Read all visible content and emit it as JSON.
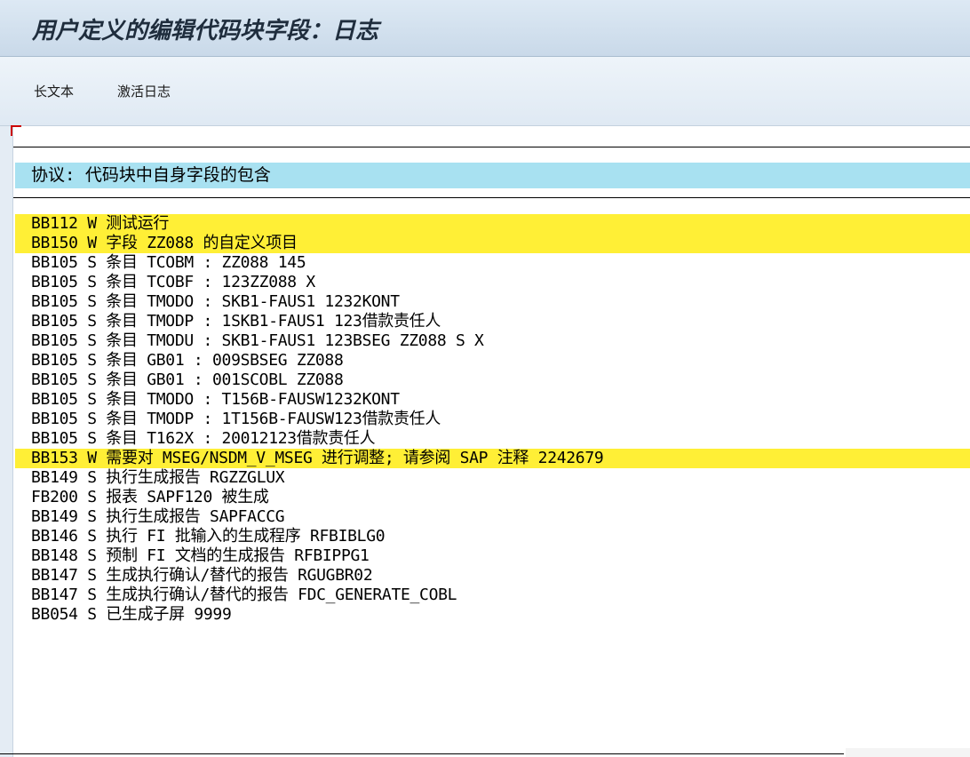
{
  "window": {
    "title": "用户定义的编辑代码块字段：日志"
  },
  "toolbar": {
    "long_text": "长文本",
    "activate_log": "激活日志"
  },
  "log": {
    "heading": "协议: 代码块中自身字段的包含",
    "rows": [
      {
        "text": "BB112 W 测试运行",
        "type": "W"
      },
      {
        "text": "BB150 W 字段 ZZ088 的自定义项目",
        "type": "W"
      },
      {
        "text": "BB105 S 条目 TCOBM : ZZ088 145",
        "type": "S"
      },
      {
        "text": "BB105 S 条目 TCOBF : 123ZZ088 X",
        "type": "S"
      },
      {
        "text": "BB105 S 条目 TMODO : SKB1-FAUS1 1232KONT",
        "type": "S"
      },
      {
        "text": "BB105 S 条目 TMODP : 1SKB1-FAUS1 123借款责任人",
        "type": "S"
      },
      {
        "text": "BB105 S 条目 TMODU : SKB1-FAUS1 123BSEG ZZ088 S X",
        "type": "S"
      },
      {
        "text": "BB105 S 条目 GB01 : 009SBSEG ZZ088",
        "type": "S"
      },
      {
        "text": "BB105 S 条目 GB01 : 001SCOBL ZZ088",
        "type": "S"
      },
      {
        "text": "BB105 S 条目 TMODO : T156B-FAUSW1232KONT",
        "type": "S"
      },
      {
        "text": "BB105 S 条目 TMODP : 1T156B-FAUSW123借款责任人",
        "type": "S"
      },
      {
        "text": "BB105 S 条目 T162X : 20012123借款责任人",
        "type": "S"
      },
      {
        "text": "BB153 W 需要对 MSEG/NSDM_V_MSEG 进行调整; 请参阅 SAP 注释 2242679",
        "type": "W"
      },
      {
        "text": "BB149 S 执行生成报告 RGZZGLUX",
        "type": "S"
      },
      {
        "text": "FB200 S 报表 SAPF120 被生成",
        "type": "S"
      },
      {
        "text": "BB149 S 执行生成报告 SAPFACCG",
        "type": "S"
      },
      {
        "text": "BB146 S 执行 FI 批输入的生成程序 RFBIBLG0",
        "type": "S"
      },
      {
        "text": "BB148 S 预制 FI 文档的生成报告 RFBIPPG1",
        "type": "S"
      },
      {
        "text": "BB147 S 生成执行确认/替代的报告 RGUGBR02",
        "type": "S"
      },
      {
        "text": "BB147 S 生成执行确认/替代的报告 FDC_GENERATE_COBL",
        "type": "S"
      },
      {
        "text": "BB054 S 已生成子屏 9999",
        "type": "S"
      }
    ]
  },
  "colors": {
    "warning_highlight": "#ffef36",
    "heading_background": "#a8e1f1"
  }
}
